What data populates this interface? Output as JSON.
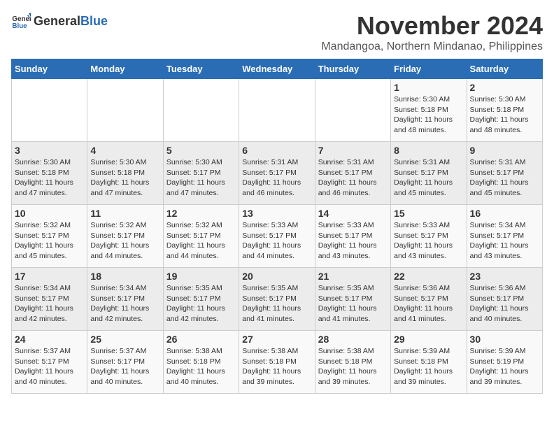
{
  "header": {
    "logo_general": "General",
    "logo_blue": "Blue",
    "month_title": "November 2024",
    "location": "Mandangoa, Northern Mindanao, Philippines"
  },
  "weekdays": [
    "Sunday",
    "Monday",
    "Tuesday",
    "Wednesday",
    "Thursday",
    "Friday",
    "Saturday"
  ],
  "weeks": [
    [
      {
        "day": "",
        "info": ""
      },
      {
        "day": "",
        "info": ""
      },
      {
        "day": "",
        "info": ""
      },
      {
        "day": "",
        "info": ""
      },
      {
        "day": "",
        "info": ""
      },
      {
        "day": "1",
        "info": "Sunrise: 5:30 AM\nSunset: 5:18 PM\nDaylight: 11 hours\nand 48 minutes."
      },
      {
        "day": "2",
        "info": "Sunrise: 5:30 AM\nSunset: 5:18 PM\nDaylight: 11 hours\nand 48 minutes."
      }
    ],
    [
      {
        "day": "3",
        "info": "Sunrise: 5:30 AM\nSunset: 5:18 PM\nDaylight: 11 hours\nand 47 minutes."
      },
      {
        "day": "4",
        "info": "Sunrise: 5:30 AM\nSunset: 5:18 PM\nDaylight: 11 hours\nand 47 minutes."
      },
      {
        "day": "5",
        "info": "Sunrise: 5:30 AM\nSunset: 5:17 PM\nDaylight: 11 hours\nand 47 minutes."
      },
      {
        "day": "6",
        "info": "Sunrise: 5:31 AM\nSunset: 5:17 PM\nDaylight: 11 hours\nand 46 minutes."
      },
      {
        "day": "7",
        "info": "Sunrise: 5:31 AM\nSunset: 5:17 PM\nDaylight: 11 hours\nand 46 minutes."
      },
      {
        "day": "8",
        "info": "Sunrise: 5:31 AM\nSunset: 5:17 PM\nDaylight: 11 hours\nand 45 minutes."
      },
      {
        "day": "9",
        "info": "Sunrise: 5:31 AM\nSunset: 5:17 PM\nDaylight: 11 hours\nand 45 minutes."
      }
    ],
    [
      {
        "day": "10",
        "info": "Sunrise: 5:32 AM\nSunset: 5:17 PM\nDaylight: 11 hours\nand 45 minutes."
      },
      {
        "day": "11",
        "info": "Sunrise: 5:32 AM\nSunset: 5:17 PM\nDaylight: 11 hours\nand 44 minutes."
      },
      {
        "day": "12",
        "info": "Sunrise: 5:32 AM\nSunset: 5:17 PM\nDaylight: 11 hours\nand 44 minutes."
      },
      {
        "day": "13",
        "info": "Sunrise: 5:33 AM\nSunset: 5:17 PM\nDaylight: 11 hours\nand 44 minutes."
      },
      {
        "day": "14",
        "info": "Sunrise: 5:33 AM\nSunset: 5:17 PM\nDaylight: 11 hours\nand 43 minutes."
      },
      {
        "day": "15",
        "info": "Sunrise: 5:33 AM\nSunset: 5:17 PM\nDaylight: 11 hours\nand 43 minutes."
      },
      {
        "day": "16",
        "info": "Sunrise: 5:34 AM\nSunset: 5:17 PM\nDaylight: 11 hours\nand 43 minutes."
      }
    ],
    [
      {
        "day": "17",
        "info": "Sunrise: 5:34 AM\nSunset: 5:17 PM\nDaylight: 11 hours\nand 42 minutes."
      },
      {
        "day": "18",
        "info": "Sunrise: 5:34 AM\nSunset: 5:17 PM\nDaylight: 11 hours\nand 42 minutes."
      },
      {
        "day": "19",
        "info": "Sunrise: 5:35 AM\nSunset: 5:17 PM\nDaylight: 11 hours\nand 42 minutes."
      },
      {
        "day": "20",
        "info": "Sunrise: 5:35 AM\nSunset: 5:17 PM\nDaylight: 11 hours\nand 41 minutes."
      },
      {
        "day": "21",
        "info": "Sunrise: 5:35 AM\nSunset: 5:17 PM\nDaylight: 11 hours\nand 41 minutes."
      },
      {
        "day": "22",
        "info": "Sunrise: 5:36 AM\nSunset: 5:17 PM\nDaylight: 11 hours\nand 41 minutes."
      },
      {
        "day": "23",
        "info": "Sunrise: 5:36 AM\nSunset: 5:17 PM\nDaylight: 11 hours\nand 40 minutes."
      }
    ],
    [
      {
        "day": "24",
        "info": "Sunrise: 5:37 AM\nSunset: 5:17 PM\nDaylight: 11 hours\nand 40 minutes."
      },
      {
        "day": "25",
        "info": "Sunrise: 5:37 AM\nSunset: 5:17 PM\nDaylight: 11 hours\nand 40 minutes."
      },
      {
        "day": "26",
        "info": "Sunrise: 5:38 AM\nSunset: 5:18 PM\nDaylight: 11 hours\nand 40 minutes."
      },
      {
        "day": "27",
        "info": "Sunrise: 5:38 AM\nSunset: 5:18 PM\nDaylight: 11 hours\nand 39 minutes."
      },
      {
        "day": "28",
        "info": "Sunrise: 5:38 AM\nSunset: 5:18 PM\nDaylight: 11 hours\nand 39 minutes."
      },
      {
        "day": "29",
        "info": "Sunrise: 5:39 AM\nSunset: 5:18 PM\nDaylight: 11 hours\nand 39 minutes."
      },
      {
        "day": "30",
        "info": "Sunrise: 5:39 AM\nSunset: 5:19 PM\nDaylight: 11 hours\nand 39 minutes."
      }
    ]
  ]
}
